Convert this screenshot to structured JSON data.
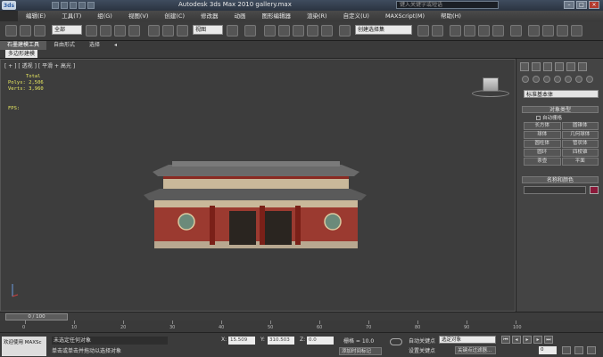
{
  "window": {
    "title": "Autodesk 3ds Max  2010   gallery.max",
    "logo": "3ds",
    "help_placeholder": "键入关键字或短语"
  },
  "menu": [
    "编辑(E)",
    "工具(T)",
    "组(G)",
    "视图(V)",
    "创建(C)",
    "修改器",
    "动画",
    "图形编辑器",
    "渲染(R)",
    "自定义(U)",
    "MAXScript(M)",
    "帮助(H)"
  ],
  "toolbar": {
    "filter": "全部",
    "ref_coord": "视图",
    "named_sel": "创建选择集"
  },
  "ribbon": {
    "tabs": [
      "石墨建模工具",
      "自由形式",
      "选择"
    ],
    "panel": "多边形建模"
  },
  "viewport": {
    "label": "[ + ] [ 透视 ] [ 平滑 + 高光 ]",
    "stats": {
      "heading": "Total",
      "polys": "Polys: 2,506",
      "verts": "Verts: 3,960"
    },
    "fps": "FPS:"
  },
  "command_panel": {
    "category": "标准基本体",
    "object_type_header": "对象类型",
    "autogrid": "自动栅格",
    "objects": [
      "长方体",
      "圆锥体",
      "球体",
      "几何球体",
      "圆柱体",
      "管状体",
      "圆环",
      "四棱锥",
      "茶壶",
      "平面"
    ],
    "name_color_header": "名称和颜色"
  },
  "timeline": {
    "slider": "0 / 100",
    "ticks": [
      "0",
      "10",
      "20",
      "30",
      "40",
      "50",
      "60",
      "70",
      "80",
      "90",
      "100"
    ]
  },
  "status": {
    "maxscript": "欢迎使用 MAXSc",
    "line1": "未选定任何对象",
    "line2": "单击或单击并拖动以选择对象",
    "x": "15.509",
    "y": "310.503",
    "z": "0.0",
    "grid": "栅格 = 10.0",
    "add_time_tag": "添加时间标记",
    "auto_key": "自动关键点",
    "set_key": "设置关键点",
    "auto_key_select": "选定对象",
    "key_filter": "关键点过滤器...",
    "frame": "0"
  },
  "colors": {
    "roof": "#5a5a5a",
    "wall": "#9b3a30",
    "beam": "#c9b89a",
    "swatch": "#8a1a3a"
  }
}
